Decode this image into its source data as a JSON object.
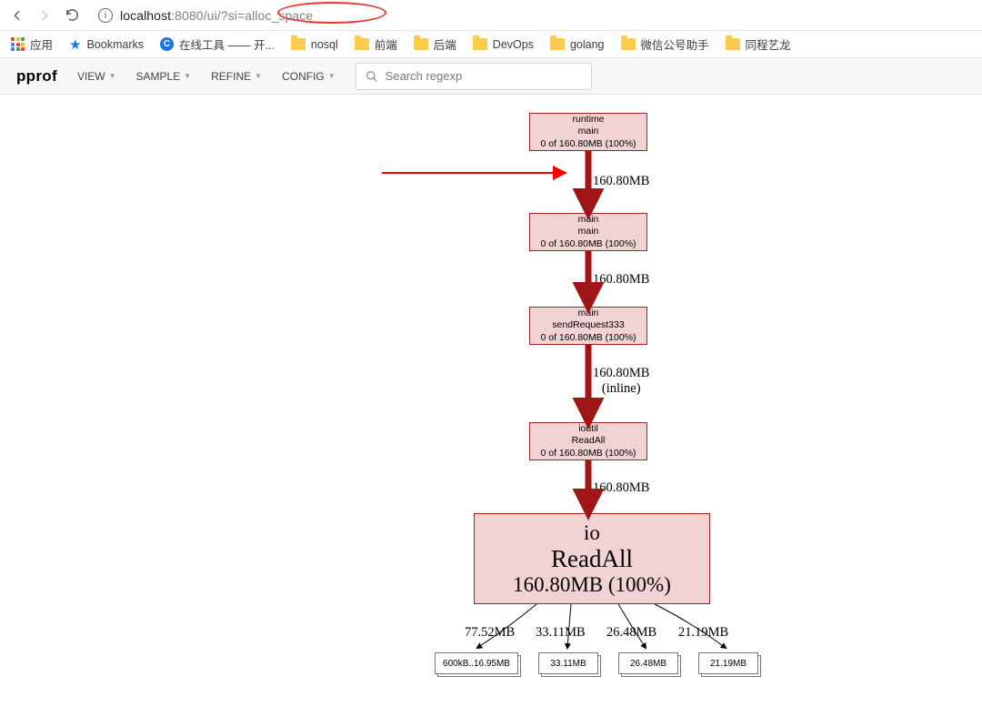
{
  "browser": {
    "url_pre": "localhost",
    "url_mid": ":8080/ui/?",
    "url_hl": "si=alloc_space"
  },
  "bookmarks": {
    "apps": "应用",
    "bookmarks": "Bookmarks",
    "online": "在线工具 —— 开...",
    "folders": [
      "nosql",
      "前端",
      "后端",
      "DevOps",
      "golang",
      "微信公号助手",
      "同程艺龙"
    ]
  },
  "pprof": {
    "logo": "pprof",
    "menu": [
      "VIEW",
      "SAMPLE",
      "REFINE",
      "CONFIG"
    ],
    "search_placeholder": "Search regexp"
  },
  "graph": {
    "nodes": [
      {
        "package": "runtime",
        "func": "main",
        "stat": "0 of 160.80MB (100%)"
      },
      {
        "package": "main",
        "func": "main",
        "stat": "0 of 160.80MB (100%)"
      },
      {
        "package": "main",
        "func": "sendRequest333",
        "stat": "0 of 160.80MB (100%)"
      },
      {
        "package": "ioutil",
        "func": "ReadAll",
        "stat": "0 of 160.80MB (100%)"
      }
    ],
    "big_node": {
      "package": "io",
      "func": "ReadAll",
      "stat": "160.80MB (100%)"
    },
    "edges": [
      "160.80MB",
      "160.80MB",
      "160.80MB\n(inline)",
      "160.80MB"
    ],
    "leaf_edges": [
      "77.52MB",
      "33.11MB",
      "26.48MB",
      "21.19MB"
    ],
    "leaves": [
      "600kB..16.95MB",
      "33.11MB",
      "26.48MB",
      "21.19MB"
    ]
  }
}
